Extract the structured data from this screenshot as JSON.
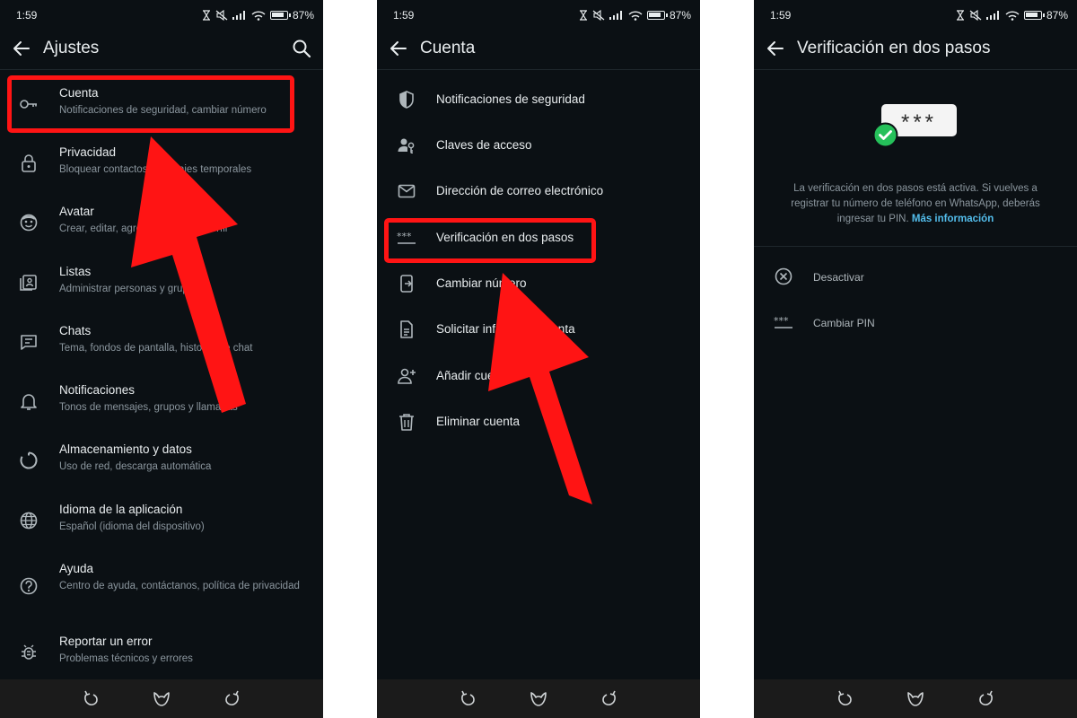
{
  "status_bar": {
    "time": "1:59",
    "battery_percent": "87%"
  },
  "screens": {
    "settings": {
      "title": "Ajustes",
      "items": [
        {
          "title": "Cuenta",
          "subtitle": "Notificaciones de seguridad, cambiar número",
          "icon": "key-icon"
        },
        {
          "title": "Privacidad",
          "subtitle": "Bloquear contactos, mensajes temporales",
          "icon": "lock-icon"
        },
        {
          "title": "Avatar",
          "subtitle": "Crear, editar, agregar a foto del perfil",
          "icon": "avatar-icon"
        },
        {
          "title": "Listas",
          "subtitle": "Administrar personas y grupos",
          "icon": "lists-icon"
        },
        {
          "title": "Chats",
          "subtitle": "Tema, fondos de pantalla, historial de chat",
          "icon": "chat-icon"
        },
        {
          "title": "Notificaciones",
          "subtitle": "Tonos de mensajes, grupos y llamadas",
          "icon": "bell-icon"
        },
        {
          "title": "Almacenamiento y datos",
          "subtitle": "Uso de red, descarga automática",
          "icon": "storage-icon"
        },
        {
          "title": "Idioma de la aplicación",
          "subtitle": "Español (idioma del dispositivo)",
          "icon": "globe-icon"
        },
        {
          "title": "Ayuda",
          "subtitle": "Centro de ayuda, contáctanos, política de privacidad",
          "icon": "help-icon"
        },
        {
          "title": "Reportar un error",
          "subtitle": "Problemas técnicos y errores",
          "icon": "bug-icon"
        }
      ]
    },
    "account": {
      "title": "Cuenta",
      "items": [
        {
          "label": "Notificaciones de seguridad",
          "icon": "shield-icon"
        },
        {
          "label": "Claves de acceso",
          "icon": "passkey-icon"
        },
        {
          "label": "Dirección de correo electrónico",
          "icon": "mail-icon"
        },
        {
          "label": "Verificación en dos pasos",
          "icon": "pin-dots-icon"
        },
        {
          "label": "Cambiar número",
          "icon": "phone-change-icon"
        },
        {
          "label": "Solicitar info de mi cuenta",
          "icon": "document-icon"
        },
        {
          "label": "Añadir cuenta",
          "icon": "add-person-icon"
        },
        {
          "label": "Eliminar cuenta",
          "icon": "trash-icon"
        }
      ]
    },
    "two_step": {
      "title": "Verificación en dos pasos",
      "pin_mask": "***",
      "info_text": "La verificación en dos pasos está activa. Si vuelves a registrar tu número de teléfono en WhatsApp, deberás ingresar tu PIN.",
      "info_link": "Más información",
      "items": [
        {
          "label": "Desactivar",
          "icon": "circle-x-icon"
        },
        {
          "label": "Cambiar PIN",
          "icon": "pin-dots-icon"
        }
      ]
    }
  },
  "colors": {
    "background": "#0b1014",
    "text": "#e9edef",
    "secondary_text": "#8b969e",
    "link": "#53bdeb",
    "highlight": "#ff1414",
    "check_green": "#25c05a"
  }
}
